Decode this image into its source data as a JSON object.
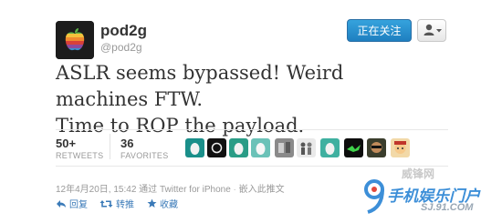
{
  "user": {
    "name": "pod2g",
    "handle": "@pod2g"
  },
  "buttons": {
    "follow_label": "正在关注"
  },
  "tweet": {
    "line1": "ASLR seems bypassed! Weird machines FTW.",
    "line2": "Time to ROP the payload."
  },
  "stats": {
    "retweets_count": "50+",
    "retweets_label": "RETWEETS",
    "favorites_count": "36",
    "favorites_label": "FAVORITES"
  },
  "favoriters": [
    {
      "icon": "egg-avatar-teal"
    },
    {
      "icon": "dark-avatar-ring"
    },
    {
      "icon": "egg-avatar-teal"
    },
    {
      "icon": "egg-avatar-teal"
    },
    {
      "icon": "egg-avatar-gray"
    },
    {
      "icon": "figures-avatar"
    },
    {
      "icon": "egg-avatar-teal"
    },
    {
      "icon": "green-splash-avatar"
    },
    {
      "icon": "sunglasses-avatar"
    },
    {
      "icon": "cartoon-face-avatar"
    }
  ],
  "meta": {
    "timestamp": "12年4月20日, 15:42",
    "via_text": "通过",
    "client": "Twitter for iPhone",
    "separator": "·",
    "embed_label": "嵌入此推文"
  },
  "actions": {
    "reply_label": "回复",
    "retweet_label": "转推",
    "favorite_label": "收藏"
  },
  "watermark": {
    "line1": "威锋网",
    "line2": "手机娱乐门户",
    "url": "SJ.91.COM"
  },
  "colors": {
    "follow_button": "#1f7fc0",
    "link": "#3a7ab8",
    "muted": "#999999",
    "watermark_blue": "#3d8fd8"
  }
}
